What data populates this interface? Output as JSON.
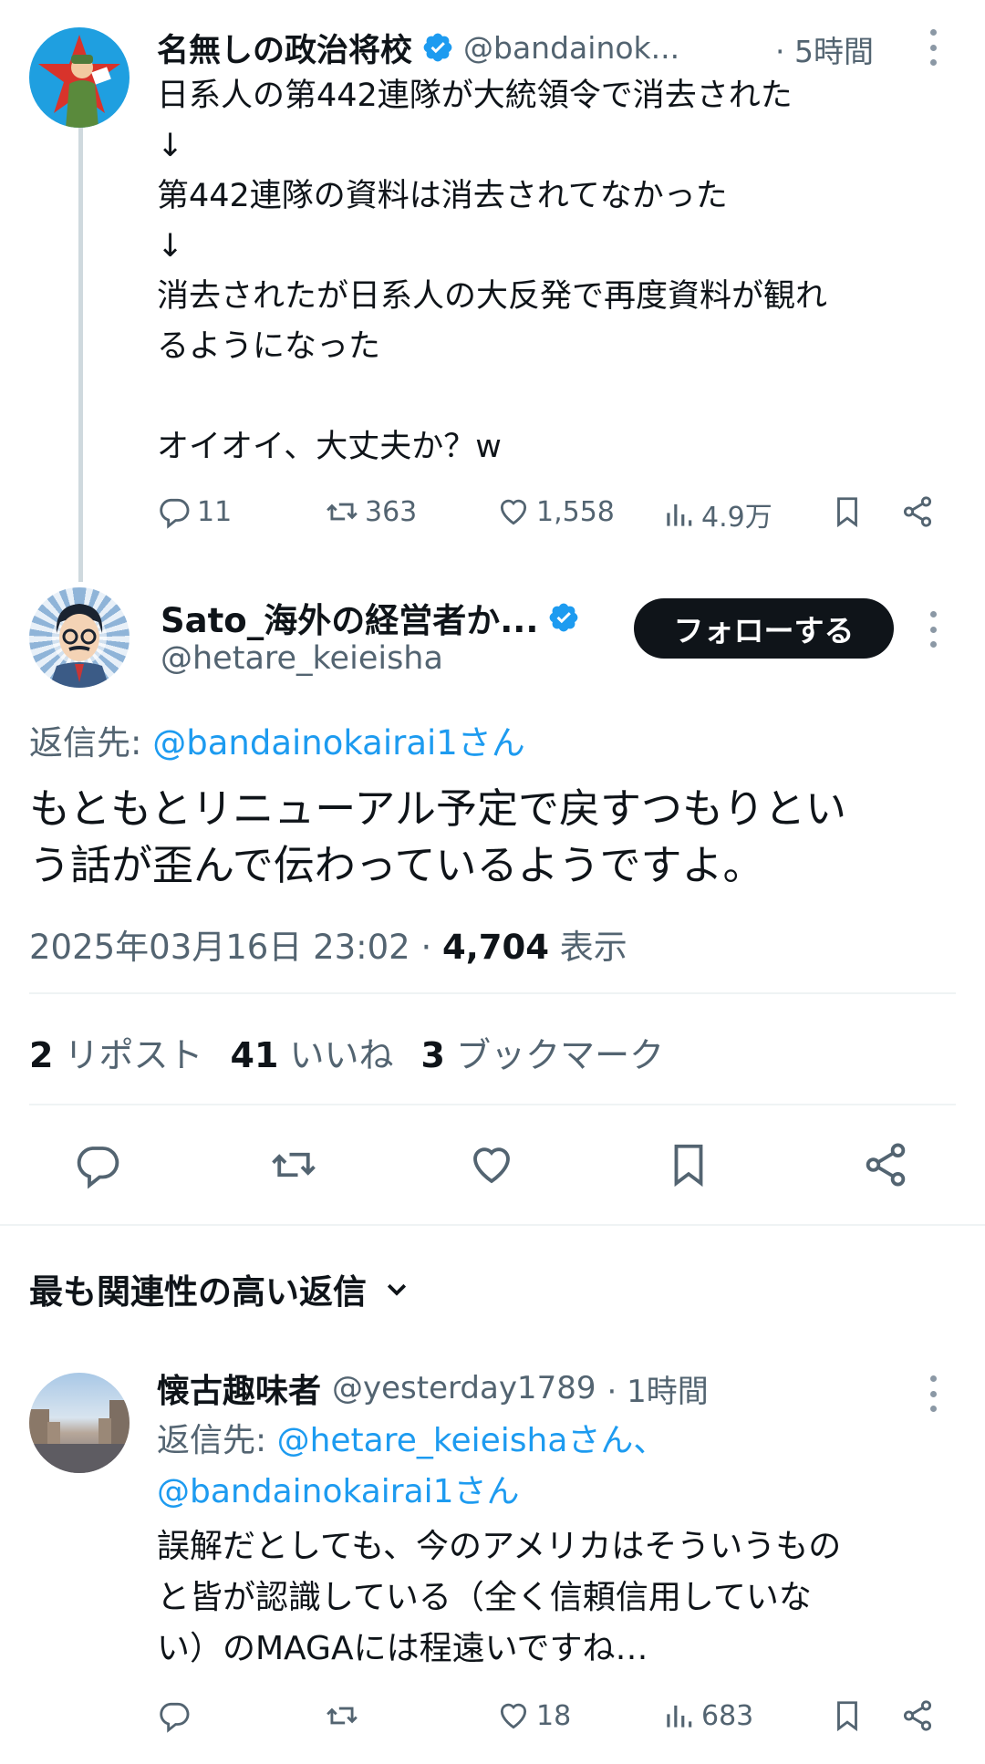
{
  "parent_tweet": {
    "author_name": "名無しの政治将校",
    "handle": "@bandainok...",
    "time": "· 5時間",
    "text_lines": [
      "日系人の第442連隊が大統領令で消去された",
      "↓",
      "第442連隊の資料は消去されてなかった",
      "↓",
      "消去されたが日系人の大反発で再度資料が観れ",
      "るようになった",
      "",
      "オイオイ、大丈夫か？w"
    ],
    "actions": {
      "replies": "11",
      "retweets": "363",
      "likes": "1,558",
      "views": "4.9万"
    }
  },
  "main_tweet": {
    "author_name": "Sato_海外の経営者か...",
    "handle": "@hetare_keieisha",
    "follow_label": "フォローする",
    "reply_to_prefix": "返信先: ",
    "reply_to_handle": "@bandainokairai1さん",
    "text_lines": [
      "もともとリニューアル予定で戻すつもりとい",
      "う話が歪んで伝わっているようですよ。"
    ],
    "timestamp": "2025年03月16日 23:02 · ",
    "views_count": "4,704",
    "views_label": " 表示",
    "stats": {
      "reposts_count": "2",
      "reposts_label": " リポスト",
      "likes_count": "41",
      "likes_label": " いいね",
      "bookmarks_count": "3",
      "bookmarks_label": " ブックマーク"
    }
  },
  "replies_section": {
    "sort_label": "最も関連性の高い返信"
  },
  "reply_tweet": {
    "author_name": "懐古趣味者",
    "handle": "@yesterday1789",
    "time": "· 1時間",
    "reply_to_prefix": "返信先: ",
    "reply_to_handle_1": "@hetare_keieishaさん、",
    "reply_to_handle_2": "@bandainokairai1さん",
    "text_lines": [
      "誤解だとしても、今のアメリカはそういうもの",
      "と皆が認識している（全く信頼信用していな",
      "い）のMAGAには程遠いですね…"
    ],
    "actions": {
      "replies": "",
      "retweets": "",
      "likes": "18",
      "views": "683"
    }
  },
  "colors": {
    "accent": "#1d9bf0",
    "text": "#0f1419",
    "muted": "#536471",
    "follow_bg": "#0f1419",
    "thread_line": "#cfd9de"
  }
}
